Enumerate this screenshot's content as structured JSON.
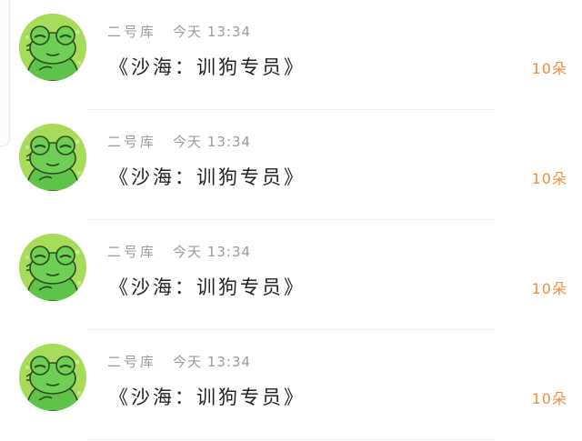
{
  "messages": [
    {
      "author": "二号库",
      "date_label": "今天",
      "time": "13:34",
      "title": "《沙海：训狗专员》",
      "count": "10朵",
      "avatar_icon": "frog-avatar-icon"
    },
    {
      "author": "二号库",
      "date_label": "今天",
      "time": "13:34",
      "title": "《沙海：训狗专员》",
      "count": "10朵",
      "avatar_icon": "frog-avatar-icon"
    },
    {
      "author": "二号库",
      "date_label": "今天",
      "time": "13:34",
      "title": "《沙海：训狗专员》",
      "count": "10朵",
      "avatar_icon": "frog-avatar-icon"
    },
    {
      "author": "二号库",
      "date_label": "今天",
      "time": "13:34",
      "title": "《沙海：训狗专员》",
      "count": "10朵",
      "avatar_icon": "frog-avatar-icon"
    }
  ],
  "colors": {
    "avatar_bg": "#a7dc5a",
    "frog_green": "#5fc34a",
    "count_orange": "#ef8e3d",
    "meta_gray": "#9a9a9a",
    "title_text": "#222222"
  }
}
